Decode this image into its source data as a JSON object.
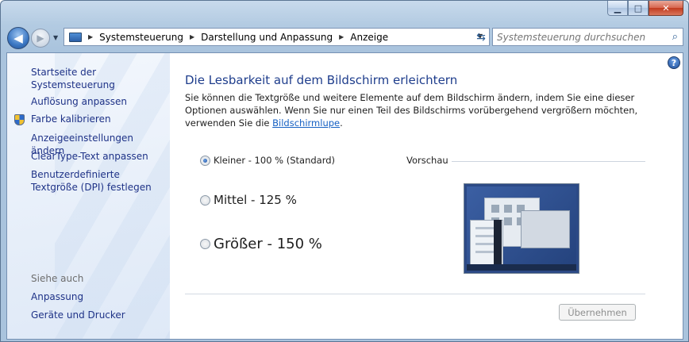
{
  "window": {
    "caption": {
      "minimize": "▁",
      "maximize": "□",
      "close": "✕"
    }
  },
  "nav": {
    "back_icon": "◀",
    "forward_icon": "▶",
    "breadcrumbs": [
      "Systemsteuerung",
      "Darstellung und Anpassung",
      "Anzeige"
    ],
    "search_placeholder": "Systemsteuerung durchsuchen"
  },
  "sidebar": {
    "home": "Startseite der Systemsteuerung",
    "links": [
      "Auflösung anpassen",
      "Farbe kalibrieren",
      "Anzeigeeinstellungen ändern",
      "ClearType-Text anpassen",
      "Benutzerdefinierte Textgröße (DPI) festlegen"
    ],
    "see_also_heading": "Siehe auch",
    "see_also": [
      "Anpassung",
      "Geräte und Drucker"
    ]
  },
  "main": {
    "title": "Die Lesbarkeit auf dem Bildschirm erleichtern",
    "description": "Sie können die Textgröße und weitere Elemente auf dem Bildschirm ändern, indem Sie eine dieser Optionen auswählen. Wenn Sie nur einen Teil des Bildschirms vorübergehend vergrößern möchten, verwenden Sie die",
    "magnifier_link": "Bildschirmlupe",
    "options": [
      {
        "label": "Kleiner - 100 % (Standard)",
        "checked": true
      },
      {
        "label": "Mittel - 125 %",
        "checked": false
      },
      {
        "label": "Größer - 150 %",
        "checked": false
      }
    ],
    "preview_label": "Vorschau",
    "apply_button": "Übernehmen"
  },
  "icons": {
    "help": "?",
    "search": "⌕",
    "refresh": "⇆"
  }
}
